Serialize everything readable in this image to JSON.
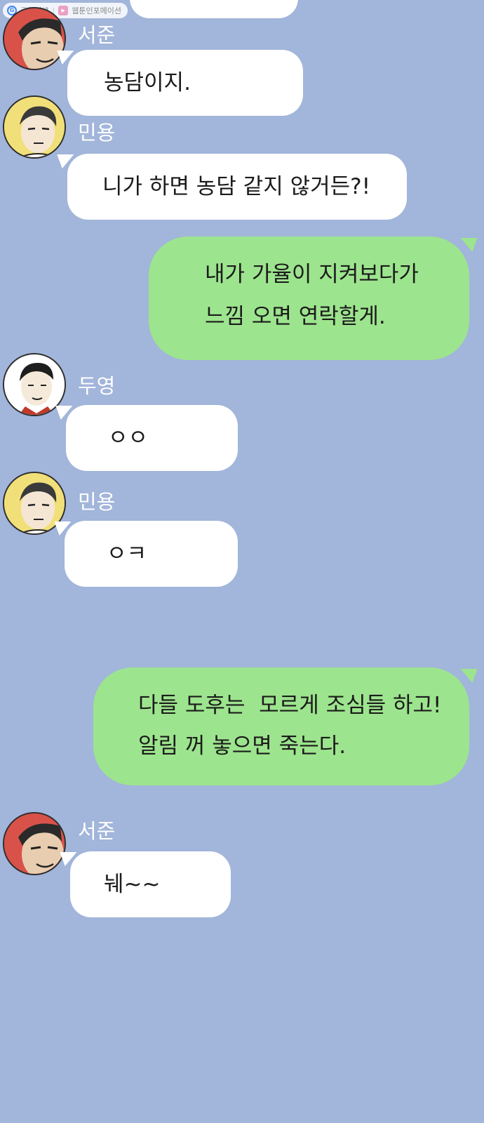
{
  "watermark": {
    "left": "구글검색",
    "right": "웹툰인포메이션"
  },
  "messages": [
    {
      "sender": "서준",
      "text": "농담이지."
    },
    {
      "sender": "민용",
      "text": "니가 하면 농담 같지 않거든?!"
    },
    {
      "sender": "",
      "lines": [
        "내가 가율이 지켜보다가",
        "느낌 오면 연락할게."
      ]
    },
    {
      "sender": "두영",
      "text": "ㅇㅇ"
    },
    {
      "sender": "민용",
      "text": "ㅇㅋ"
    },
    {
      "sender": "",
      "lines": [
        "다들 도후는  모르게 조심들 하고!",
        "알림 꺼 놓으면 죽는다."
      ]
    },
    {
      "sender": "서준",
      "text": "눼~~"
    }
  ],
  "colors": {
    "background": "#a2b5da",
    "incoming_bubble": "#ffffff",
    "outgoing_bubble": "#9de48e"
  }
}
